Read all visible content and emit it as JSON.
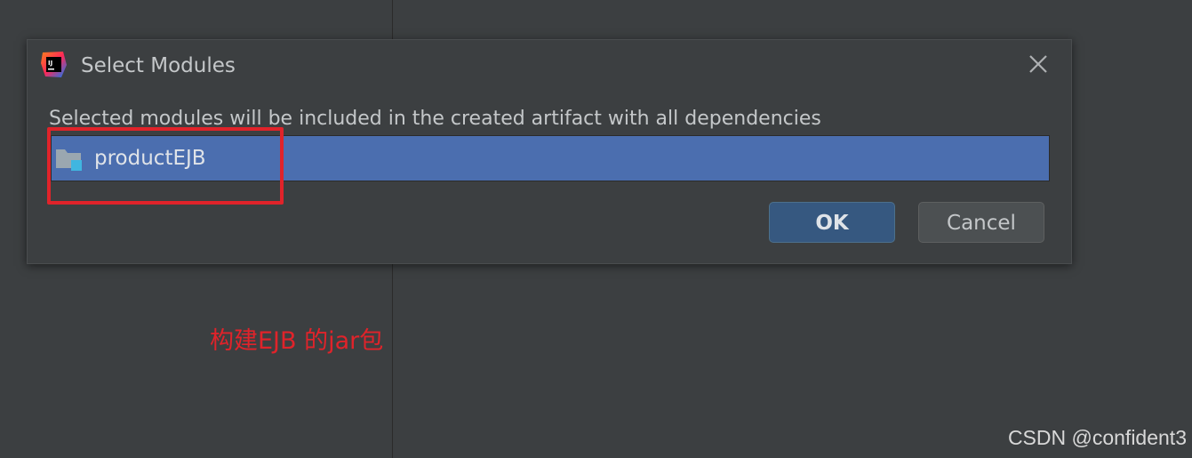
{
  "dialog": {
    "title": "Select Modules",
    "app_icon": "intellij-idea-icon",
    "close_icon": "close-icon",
    "description": "Selected modules will be included in the created artifact with all dependencies",
    "modules": [
      {
        "label": "productEJB",
        "icon": "module-folder-icon",
        "selected": true
      }
    ],
    "buttons": {
      "ok": "OK",
      "cancel": "Cancel"
    }
  },
  "annotation": {
    "text": "构建EJB 的jar包",
    "color": "#e0232a"
  },
  "watermark": "CSDN @confident3",
  "colors": {
    "background": "#3c3f41",
    "selection": "#4b6eaf",
    "ok_button": "#365880",
    "cancel_button": "#4c5052"
  }
}
